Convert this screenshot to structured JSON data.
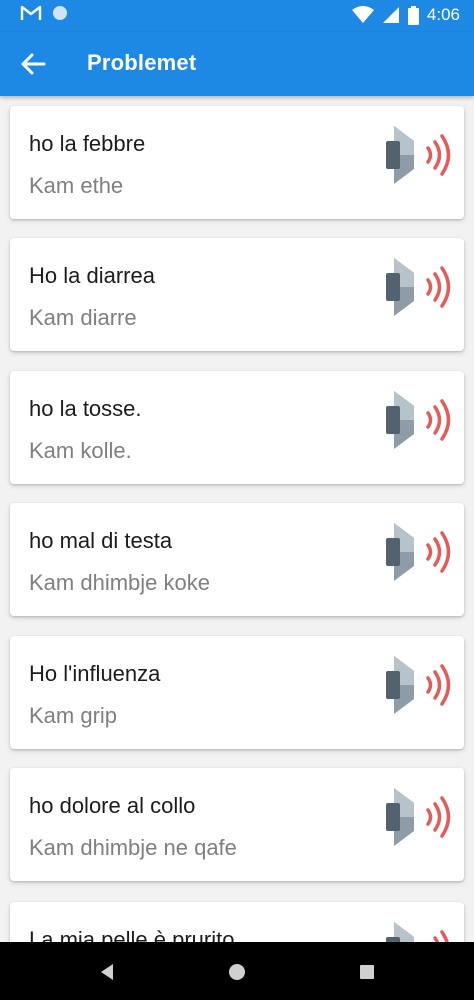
{
  "status_bar": {
    "time": "4:06",
    "icons": [
      "gmail-icon",
      "circle-notification-icon",
      "wifi-icon",
      "signal-icon",
      "battery-icon"
    ]
  },
  "app_bar": {
    "title": "Problemet",
    "back_icon": "arrow-left-icon"
  },
  "colors": {
    "primary": "#1e88e5",
    "speaker_waves": "#e85a5a",
    "translation_text": "#808080"
  },
  "phrases": [
    {
      "phrase": "ho la febbre",
      "translation": "Kam ethe"
    },
    {
      "phrase": "Ho la diarrea",
      "translation": "Kam diarre"
    },
    {
      "phrase": "ho la tosse.",
      "translation": "Kam kolle."
    },
    {
      "phrase": "ho mal di testa",
      "translation": "Kam dhimbje koke"
    },
    {
      "phrase": "Ho l'influenza",
      "translation": "Kam grip"
    },
    {
      "phrase": "ho dolore al collo",
      "translation": "Kam dhimbje ne qafe"
    },
    {
      "phrase": "La mia pelle è prurito",
      "translation": ""
    }
  ],
  "nav_bar": {
    "icons": [
      "back-triangle-icon",
      "home-circle-icon",
      "recents-square-icon"
    ]
  }
}
